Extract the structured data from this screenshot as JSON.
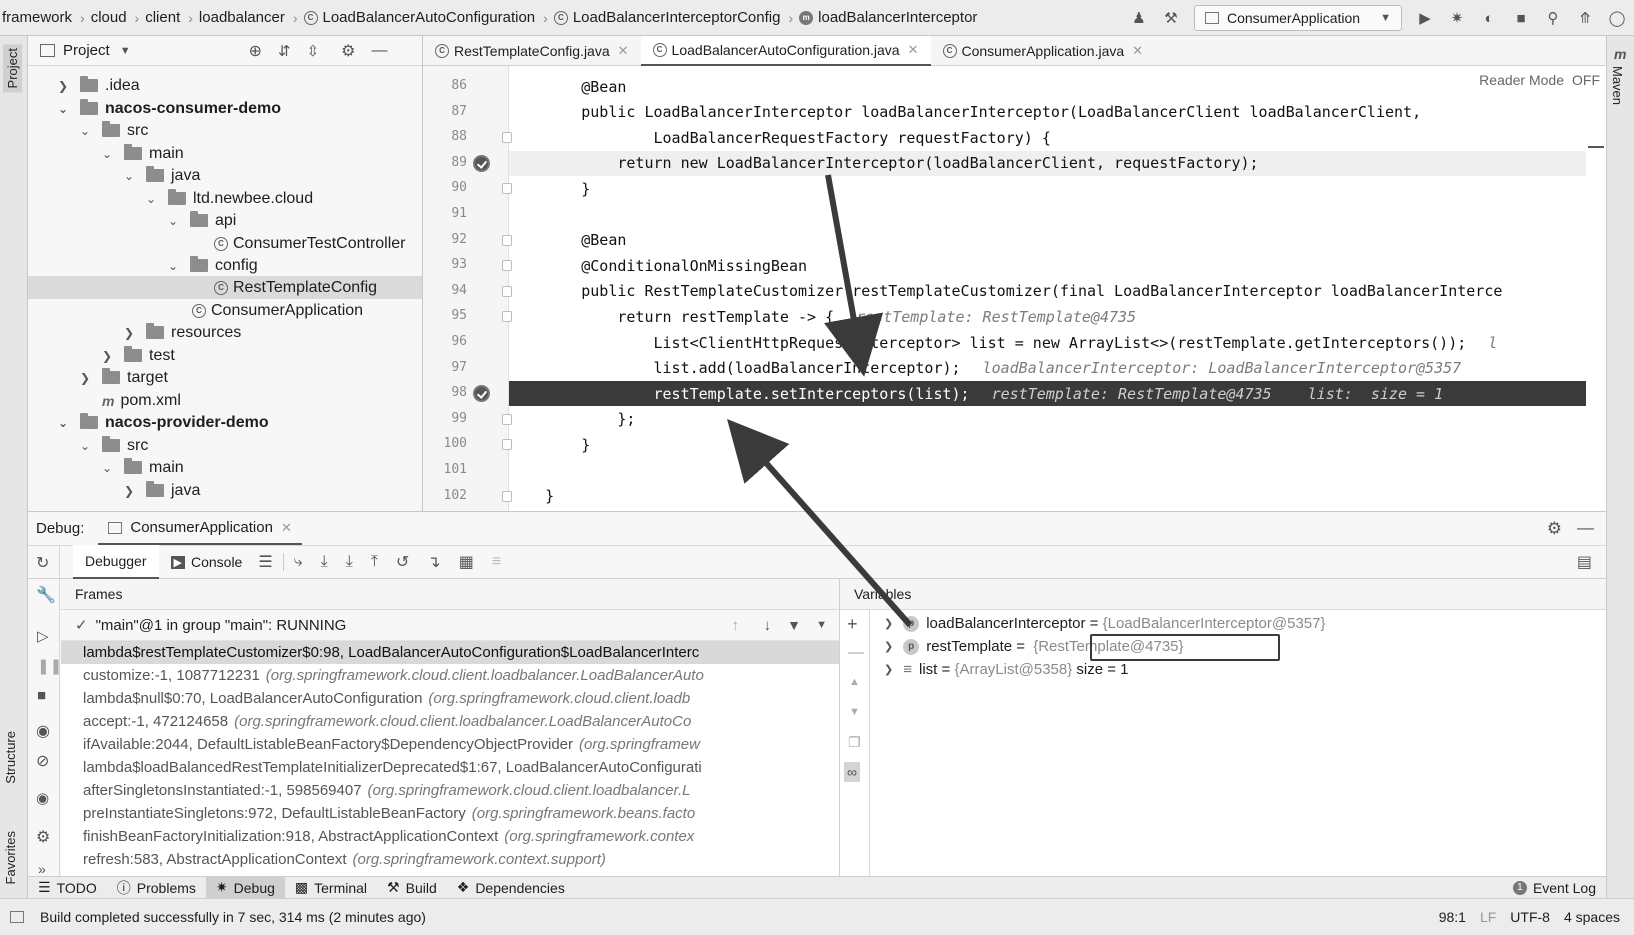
{
  "navbar": {
    "breadcrumbs": [
      "framework",
      "cloud",
      "client",
      "loadbalancer",
      "LoadBalancerAutoConfiguration",
      "LoadBalancerInterceptorConfig",
      "loadBalancerInterceptor"
    ],
    "run_config": "ConsumerApplication"
  },
  "left_stripe": {
    "project": "Project",
    "structure": "Structure",
    "favorites": "Favorites"
  },
  "right_stripe": {
    "maven": "Maven"
  },
  "project": {
    "title": "Project",
    "tree": [
      {
        "label": ".idea",
        "bold": false
      },
      {
        "label": "nacos-consumer-demo",
        "bold": true
      },
      {
        "label": "src",
        "bold": false
      },
      {
        "label": "main",
        "bold": false
      },
      {
        "label": "java",
        "bold": false
      },
      {
        "label": "ltd.newbee.cloud",
        "bold": false
      },
      {
        "label": "api",
        "bold": false
      },
      {
        "label": "ConsumerTestController",
        "bold": false
      },
      {
        "label": "config",
        "bold": false
      },
      {
        "label": "RestTemplateConfig",
        "bold": false
      },
      {
        "label": "ConsumerApplication",
        "bold": false
      },
      {
        "label": "resources",
        "bold": false
      },
      {
        "label": "test",
        "bold": false
      },
      {
        "label": "target",
        "bold": false
      },
      {
        "label": "pom.xml",
        "bold": false
      },
      {
        "label": "nacos-provider-demo",
        "bold": true
      },
      {
        "label": "src",
        "bold": false
      },
      {
        "label": "main",
        "bold": false
      },
      {
        "label": "java",
        "bold": false
      }
    ]
  },
  "editor": {
    "tabs": [
      "RestTemplateConfig.java",
      "LoadBalancerAutoConfiguration.java",
      "ConsumerApplication.java"
    ],
    "reader_mode": "Reader Mode",
    "reader_off": "OFF",
    "lines": [
      {
        "no": "86",
        "code": "        @Bean",
        "hint": ""
      },
      {
        "no": "87",
        "code": "        public LoadBalancerInterceptor loadBalancerInterceptor(LoadBalancerClient loadBalancerClient,",
        "hint": ""
      },
      {
        "no": "88",
        "code": "                LoadBalancerRequestFactory requestFactory) {",
        "hint": ""
      },
      {
        "no": "89",
        "code": "            return new LoadBalancerInterceptor(loadBalancerClient, requestFactory);",
        "hint": ""
      },
      {
        "no": "90",
        "code": "        }",
        "hint": ""
      },
      {
        "no": "91",
        "code": "",
        "hint": ""
      },
      {
        "no": "92",
        "code": "        @Bean",
        "hint": ""
      },
      {
        "no": "93",
        "code": "        @ConditionalOnMissingBean",
        "hint": ""
      },
      {
        "no": "94",
        "code": "        public RestTemplateCustomizer restTemplateCustomizer(final LoadBalancerInterceptor loadBalancerInterce",
        "hint": ""
      },
      {
        "no": "95",
        "code": "            return restTemplate -> {",
        "hint": "restTemplate: RestTemplate@4735"
      },
      {
        "no": "96",
        "code": "                List<ClientHttpRequestInterceptor> list = new ArrayList<>(restTemplate.getInterceptors());",
        "hint": "l"
      },
      {
        "no": "97",
        "code": "                list.add(loadBalancerInterceptor);",
        "hint": "loadBalancerInterceptor: LoadBalancerInterceptor@5357"
      },
      {
        "no": "98",
        "code": "                restTemplate.setInterceptors(list);",
        "hint": "restTemplate: RestTemplate@4735    list:  size = 1"
      },
      {
        "no": "99",
        "code": "            };",
        "hint": ""
      },
      {
        "no": "100",
        "code": "        }",
        "hint": ""
      },
      {
        "no": "101",
        "code": "",
        "hint": ""
      },
      {
        "no": "102",
        "code": "    }",
        "hint": ""
      }
    ]
  },
  "debug": {
    "label": "Debug:",
    "session": "ConsumerApplication",
    "tabs": {
      "debugger": "Debugger",
      "console": "Console"
    },
    "frames_title": "Frames",
    "thread": "\"main\"@1 in group \"main\": RUNNING",
    "frames": [
      {
        "method": "lambda$restTemplateCustomizer$0:98, LoadBalancerAutoConfiguration$LoadBalancerInterc",
        "pkg": ""
      },
      {
        "method": "customize:-1, 1087712231",
        "pkg": "(org.springframework.cloud.client.loadbalancer.LoadBalancerAuto"
      },
      {
        "method": "lambda$null$0:70, LoadBalancerAutoConfiguration",
        "pkg": "(org.springframework.cloud.client.loadb"
      },
      {
        "method": "accept:-1, 472124658",
        "pkg": "(org.springframework.cloud.client.loadbalancer.LoadBalancerAutoCo"
      },
      {
        "method": "ifAvailable:2044, DefaultListableBeanFactory$DependencyObjectProvider",
        "pkg": "(org.springframew"
      },
      {
        "method": "lambda$loadBalancedRestTemplateInitializerDeprecated$1:67, LoadBalancerAutoConfigurati",
        "pkg": ""
      },
      {
        "method": "afterSingletonsInstantiated:-1, 598569407",
        "pkg": "(org.springframework.cloud.client.loadbalancer.L"
      },
      {
        "method": "preInstantiateSingletons:972, DefaultListableBeanFactory",
        "pkg": "(org.springframework.beans.facto"
      },
      {
        "method": "finishBeanFactoryInitialization:918, AbstractApplicationContext",
        "pkg": "(org.springframework.contex"
      },
      {
        "method": "refresh:583, AbstractApplicationContext",
        "pkg": "(org.springframework.context.support)"
      }
    ],
    "variables_title": "Variables",
    "variables": [
      {
        "name": "loadBalancerInterceptor",
        "eq": " = ",
        "value": "{LoadBalancerInterceptor@5357}",
        "extra": ""
      },
      {
        "name": "restTemplate",
        "eq": " = ",
        "value": "{RestTemplate@4735}",
        "extra": ""
      },
      {
        "name": "list",
        "eq": " = ",
        "value": "{ArrayList@5358}",
        "extra": " size = 1"
      }
    ]
  },
  "tool_windows": {
    "todo": "TODO",
    "problems": "Problems",
    "debug": "Debug",
    "terminal": "Terminal",
    "build": "Build",
    "dependencies": "Dependencies",
    "event_log": "Event Log"
  },
  "status": {
    "message": "Build completed successfully in 7 sec, 314 ms (2 minutes ago)",
    "position": "98:1",
    "line_sep": "LF",
    "encoding": "UTF-8",
    "indent": "4 spaces"
  }
}
